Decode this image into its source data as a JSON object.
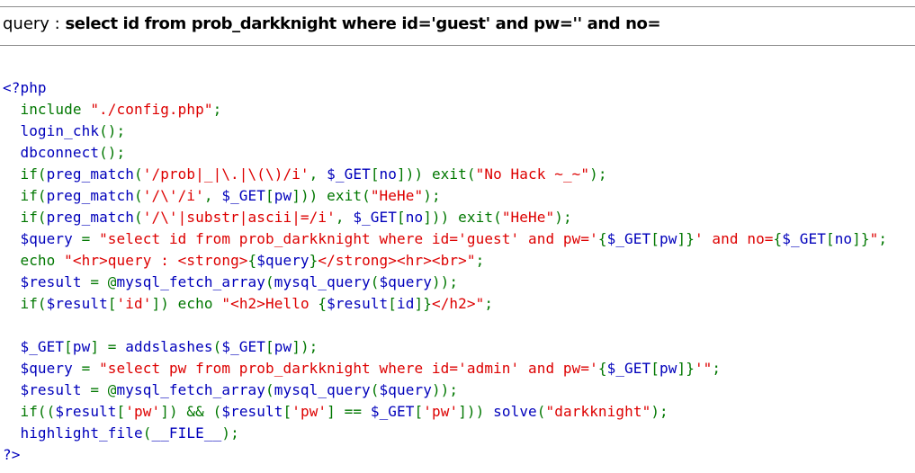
{
  "query_display": {
    "label": "query : ",
    "sql": "select id from prob_darkknight where id='guest' and pw='' and no="
  },
  "colors": {
    "default": "#0000bb",
    "keyword": "#007700",
    "string": "#dd0000",
    "rule": "#8c8c8c",
    "background": "#ffffff"
  },
  "source_code": {
    "lines": [
      [
        {
          "t": "default",
          "v": "<?php"
        }
      ],
      [
        {
          "t": "keyword",
          "v": "  include "
        },
        {
          "t": "string",
          "v": "\"./config.php\""
        },
        {
          "t": "keyword",
          "v": ";"
        }
      ],
      [
        {
          "t": "default",
          "v": "  login_chk"
        },
        {
          "t": "keyword",
          "v": "();"
        }
      ],
      [
        {
          "t": "default",
          "v": "  dbconnect"
        },
        {
          "t": "keyword",
          "v": "();"
        }
      ],
      [
        {
          "t": "keyword",
          "v": "  if("
        },
        {
          "t": "default",
          "v": "preg_match"
        },
        {
          "t": "keyword",
          "v": "("
        },
        {
          "t": "string",
          "v": "'/prob|_|\\.|\\(\\)/i'"
        },
        {
          "t": "keyword",
          "v": ", "
        },
        {
          "t": "default",
          "v": "$_GET"
        },
        {
          "t": "keyword",
          "v": "["
        },
        {
          "t": "default",
          "v": "no"
        },
        {
          "t": "keyword",
          "v": "])) exit("
        },
        {
          "t": "string",
          "v": "\"No Hack ~_~\""
        },
        {
          "t": "keyword",
          "v": ");"
        }
      ],
      [
        {
          "t": "keyword",
          "v": "  if("
        },
        {
          "t": "default",
          "v": "preg_match"
        },
        {
          "t": "keyword",
          "v": "("
        },
        {
          "t": "string",
          "v": "'/\\'/i'"
        },
        {
          "t": "keyword",
          "v": ", "
        },
        {
          "t": "default",
          "v": "$_GET"
        },
        {
          "t": "keyword",
          "v": "["
        },
        {
          "t": "default",
          "v": "pw"
        },
        {
          "t": "keyword",
          "v": "])) exit("
        },
        {
          "t": "string",
          "v": "\"HeHe\""
        },
        {
          "t": "keyword",
          "v": ");"
        }
      ],
      [
        {
          "t": "keyword",
          "v": "  if("
        },
        {
          "t": "default",
          "v": "preg_match"
        },
        {
          "t": "keyword",
          "v": "("
        },
        {
          "t": "string",
          "v": "'/\\'|substr|ascii|=/i'"
        },
        {
          "t": "keyword",
          "v": ", "
        },
        {
          "t": "default",
          "v": "$_GET"
        },
        {
          "t": "keyword",
          "v": "["
        },
        {
          "t": "default",
          "v": "no"
        },
        {
          "t": "keyword",
          "v": "])) exit("
        },
        {
          "t": "string",
          "v": "\"HeHe\""
        },
        {
          "t": "keyword",
          "v": ");"
        }
      ],
      [
        {
          "t": "default",
          "v": "  $query "
        },
        {
          "t": "keyword",
          "v": "= "
        },
        {
          "t": "string",
          "v": "\"select id from prob_darkknight where id='guest' and pw='"
        },
        {
          "t": "keyword",
          "v": "{"
        },
        {
          "t": "default",
          "v": "$_GET"
        },
        {
          "t": "keyword",
          "v": "["
        },
        {
          "t": "default",
          "v": "pw"
        },
        {
          "t": "keyword",
          "v": "]}"
        },
        {
          "t": "string",
          "v": "' and no="
        },
        {
          "t": "keyword",
          "v": "{"
        },
        {
          "t": "default",
          "v": "$_GET"
        },
        {
          "t": "keyword",
          "v": "["
        },
        {
          "t": "default",
          "v": "no"
        },
        {
          "t": "keyword",
          "v": "]}"
        },
        {
          "t": "string",
          "v": "\""
        },
        {
          "t": "keyword",
          "v": ";"
        }
      ],
      [
        {
          "t": "keyword",
          "v": "  echo "
        },
        {
          "t": "string",
          "v": "\"<hr>query : <strong>"
        },
        {
          "t": "keyword",
          "v": "{"
        },
        {
          "t": "default",
          "v": "$query"
        },
        {
          "t": "keyword",
          "v": "}"
        },
        {
          "t": "string",
          "v": "</strong><hr><br>\""
        },
        {
          "t": "keyword",
          "v": ";"
        }
      ],
      [
        {
          "t": "default",
          "v": "  $result "
        },
        {
          "t": "keyword",
          "v": "= @"
        },
        {
          "t": "default",
          "v": "mysql_fetch_array"
        },
        {
          "t": "keyword",
          "v": "("
        },
        {
          "t": "default",
          "v": "mysql_query"
        },
        {
          "t": "keyword",
          "v": "("
        },
        {
          "t": "default",
          "v": "$query"
        },
        {
          "t": "keyword",
          "v": "));"
        }
      ],
      [
        {
          "t": "keyword",
          "v": "  if("
        },
        {
          "t": "default",
          "v": "$result"
        },
        {
          "t": "keyword",
          "v": "["
        },
        {
          "t": "string",
          "v": "'id'"
        },
        {
          "t": "keyword",
          "v": "]) echo "
        },
        {
          "t": "string",
          "v": "\"<h2>Hello "
        },
        {
          "t": "keyword",
          "v": "{"
        },
        {
          "t": "default",
          "v": "$result"
        },
        {
          "t": "keyword",
          "v": "["
        },
        {
          "t": "default",
          "v": "id"
        },
        {
          "t": "keyword",
          "v": "]}"
        },
        {
          "t": "string",
          "v": "</h2>\""
        },
        {
          "t": "keyword",
          "v": ";"
        }
      ],
      [
        {
          "t": "default",
          "v": ""
        }
      ],
      [
        {
          "t": "default",
          "v": "  $_GET"
        },
        {
          "t": "keyword",
          "v": "["
        },
        {
          "t": "default",
          "v": "pw"
        },
        {
          "t": "keyword",
          "v": "] = "
        },
        {
          "t": "default",
          "v": "addslashes"
        },
        {
          "t": "keyword",
          "v": "("
        },
        {
          "t": "default",
          "v": "$_GET"
        },
        {
          "t": "keyword",
          "v": "["
        },
        {
          "t": "default",
          "v": "pw"
        },
        {
          "t": "keyword",
          "v": "]);"
        }
      ],
      [
        {
          "t": "default",
          "v": "  $query "
        },
        {
          "t": "keyword",
          "v": "= "
        },
        {
          "t": "string",
          "v": "\"select pw from prob_darkknight where id='admin' and pw='"
        },
        {
          "t": "keyword",
          "v": "{"
        },
        {
          "t": "default",
          "v": "$_GET"
        },
        {
          "t": "keyword",
          "v": "["
        },
        {
          "t": "default",
          "v": "pw"
        },
        {
          "t": "keyword",
          "v": "]}"
        },
        {
          "t": "string",
          "v": "'\""
        },
        {
          "t": "keyword",
          "v": ";"
        }
      ],
      [
        {
          "t": "default",
          "v": "  $result "
        },
        {
          "t": "keyword",
          "v": "= @"
        },
        {
          "t": "default",
          "v": "mysql_fetch_array"
        },
        {
          "t": "keyword",
          "v": "("
        },
        {
          "t": "default",
          "v": "mysql_query"
        },
        {
          "t": "keyword",
          "v": "("
        },
        {
          "t": "default",
          "v": "$query"
        },
        {
          "t": "keyword",
          "v": "));"
        }
      ],
      [
        {
          "t": "keyword",
          "v": "  if(("
        },
        {
          "t": "default",
          "v": "$result"
        },
        {
          "t": "keyword",
          "v": "["
        },
        {
          "t": "string",
          "v": "'pw'"
        },
        {
          "t": "keyword",
          "v": "]) && ("
        },
        {
          "t": "default",
          "v": "$result"
        },
        {
          "t": "keyword",
          "v": "["
        },
        {
          "t": "string",
          "v": "'pw'"
        },
        {
          "t": "keyword",
          "v": "] == "
        },
        {
          "t": "default",
          "v": "$_GET"
        },
        {
          "t": "keyword",
          "v": "["
        },
        {
          "t": "string",
          "v": "'pw'"
        },
        {
          "t": "keyword",
          "v": "])) "
        },
        {
          "t": "default",
          "v": "solve"
        },
        {
          "t": "keyword",
          "v": "("
        },
        {
          "t": "string",
          "v": "\"darkknight\""
        },
        {
          "t": "keyword",
          "v": ");"
        }
      ],
      [
        {
          "t": "default",
          "v": "  highlight_file"
        },
        {
          "t": "keyword",
          "v": "("
        },
        {
          "t": "default",
          "v": "__FILE__"
        },
        {
          "t": "keyword",
          "v": ");"
        }
      ],
      [
        {
          "t": "default",
          "v": "?>"
        }
      ]
    ]
  }
}
